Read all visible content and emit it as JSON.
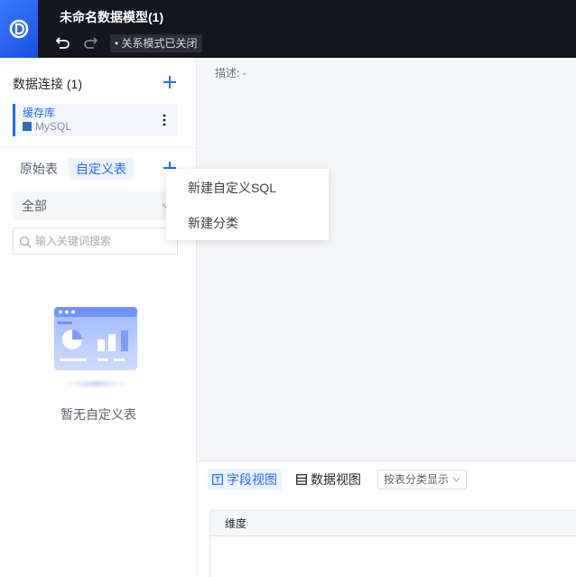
{
  "header": {
    "title": "未命名数据模型(1)",
    "mode_badge": "• 关系模式已关闭"
  },
  "sidebar": {
    "connections_title": "数据连接 (1)",
    "connection": {
      "name": "缓存库",
      "type": "MySQL"
    },
    "tabs": {
      "raw": "原始表",
      "custom": "自定义表"
    },
    "filter_value": "全部",
    "search_placeholder": "输入关键词搜索",
    "empty_text": "暂无自定义表"
  },
  "dropdown": {
    "items": [
      "新建自定义SQL",
      "新建分类"
    ]
  },
  "main": {
    "description": "描述: -",
    "bottom_tabs": {
      "field_view": "字段视图",
      "data_view": "数据视图"
    },
    "group_select": "按表分类显示",
    "grid_header": "维度"
  },
  "colors": {
    "accent": "#1e6bff",
    "topbar": "#14171f"
  }
}
